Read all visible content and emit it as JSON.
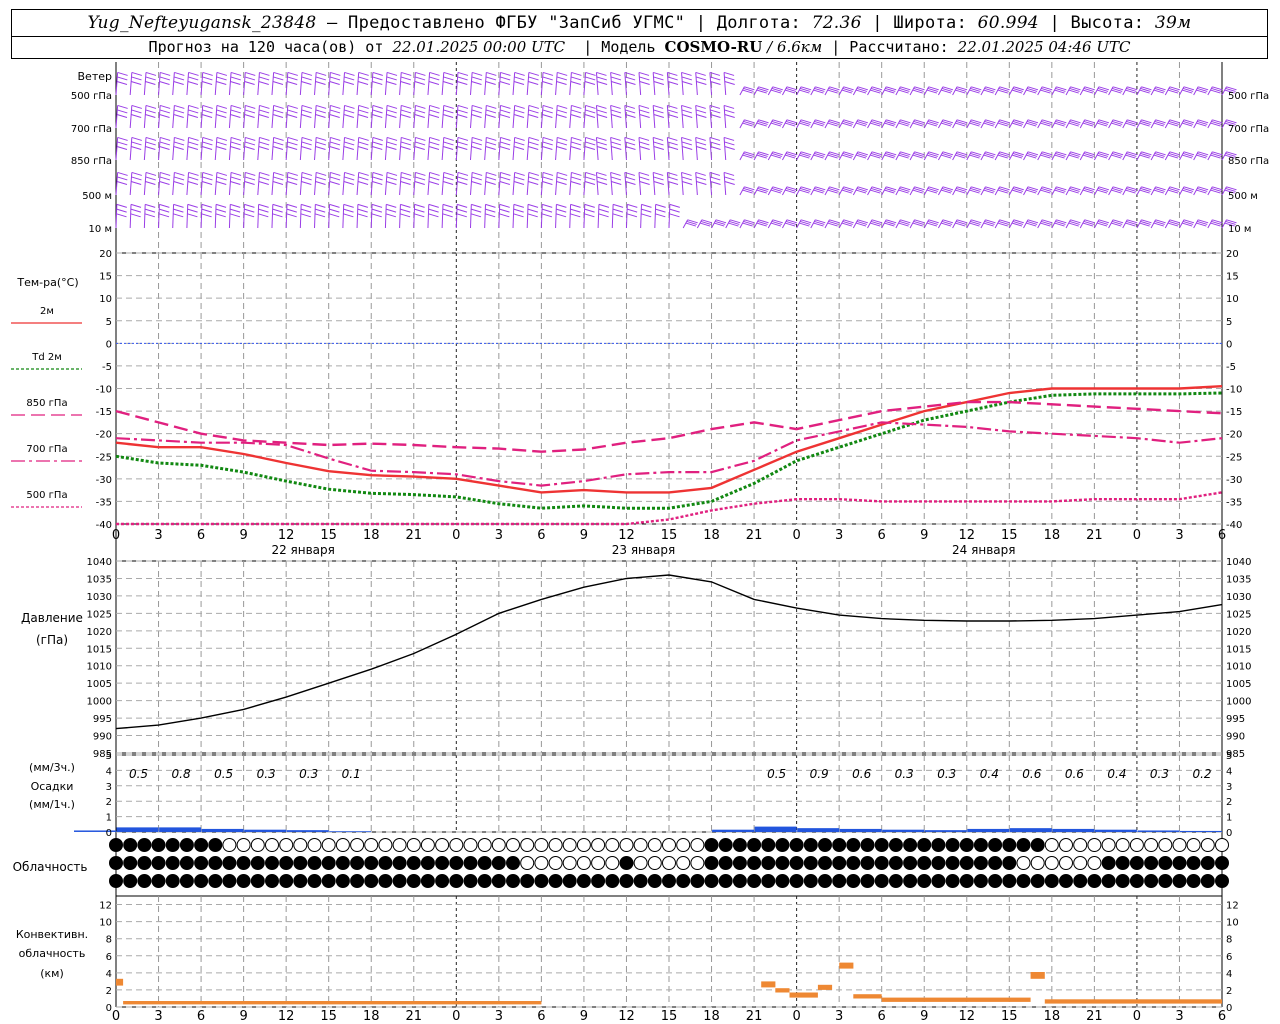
{
  "header": {
    "station": "Yug_Nefteyugansk_23848",
    "provider": " – Предоставлено ФГБУ \"ЗапСиб УГМС\" | Долгота: ",
    "lon": "72.36",
    "lat_label": " | Широта: ",
    "lat": "60.994",
    "alt_label": " | Высота: ",
    "alt": "39м",
    "forecast_label": "Прогноз на 120 часа(ов) от ",
    "run_time": "22.01.2025 00:00 UTC",
    "model_label": "  | Модель ",
    "model": "COSMO-RU",
    "resolution": " / 6.6км",
    "calc_label": " | Рассчитано: ",
    "calc_time": "22.01.2025 04:46 UTC"
  },
  "colors": {
    "wind": "#9a3de6",
    "t2m": "#ee3333",
    "td2m": "#118811",
    "t850": "#e0207f",
    "t700": "#e0207f",
    "t500": "#e0207f",
    "zero_line": "#3355ee",
    "pressure": "#000000",
    "precip": "#2255dd",
    "conv": "#ee8833"
  },
  "chart_data": [
    {
      "type": "wind_barbs",
      "label": "Ветер",
      "levels": [
        "500 гПа",
        "700 гПа",
        "850 гПа",
        "500 м",
        "10  м"
      ]
    },
    {
      "type": "line",
      "ylabel": "Тем-ра(°C)",
      "ylim": [
        -40,
        20
      ],
      "yticks": [
        20,
        15,
        10,
        5,
        0,
        -5,
        -10,
        -15,
        -20,
        -25,
        -30,
        -35,
        -40
      ],
      "x_hours": [
        0,
        3,
        6,
        9,
        12,
        15,
        18,
        21,
        24,
        27,
        30,
        33,
        36,
        39,
        42,
        45,
        48,
        51,
        54,
        57,
        60,
        63,
        66,
        69,
        72,
        75,
        78
      ],
      "x_tick_labels": [
        "0",
        "3",
        "6",
        "9",
        "12",
        "15",
        "18",
        "21",
        "0",
        "3",
        "6",
        "9",
        "12",
        "15",
        "18",
        "21",
        "0",
        "3",
        "6",
        "9",
        "12",
        "15",
        "18",
        "21",
        "0",
        "3",
        "6"
      ],
      "day_labels": [
        "22 января",
        "23 января",
        "24 января"
      ],
      "series": [
        {
          "name": "2м",
          "key": "t2m",
          "values": [
            -22,
            -23,
            -23,
            -24.5,
            -26.5,
            -28.3,
            -29.2,
            -29.5,
            -30,
            -31.5,
            -33,
            -32.5,
            -33,
            -33,
            -32,
            -28,
            -24,
            -21,
            -18,
            -15,
            -13,
            -11,
            -10,
            -10,
            -10,
            -10,
            -9.5
          ]
        },
        {
          "name": "Td  2м",
          "key": "td2m",
          "values": [
            -25,
            -26.5,
            -27,
            -28.5,
            -30.5,
            -32.3,
            -33.2,
            -33.5,
            -34,
            -35.5,
            -36.5,
            -36,
            -36.5,
            -36.5,
            -35,
            -31,
            -26,
            -23,
            -20,
            -17,
            -15,
            -13,
            -11.5,
            -11.2,
            -11.2,
            -11.2,
            -11
          ]
        },
        {
          "name": "850 гПа",
          "key": "t850",
          "values": [
            -15,
            -17.5,
            -20,
            -21.5,
            -22,
            -22.5,
            -22.2,
            -22.5,
            -23,
            -23.3,
            -24,
            -23.5,
            -22,
            -21,
            -19,
            -17.5,
            -19,
            -17,
            -15,
            -14,
            -13,
            -13,
            -13.5,
            -14,
            -14.5,
            -15,
            -15.5
          ]
        },
        {
          "name": "700 гПа",
          "key": "t700",
          "values": [
            -21,
            -21.5,
            -22,
            -22,
            -22.5,
            -25.5,
            -28.2,
            -28.5,
            -29,
            -30.5,
            -31.5,
            -30.5,
            -29,
            -28.5,
            -28.5,
            -26,
            -21.5,
            -19.5,
            -17.5,
            -18,
            -18.5,
            -19.5,
            -20,
            -20.5,
            -21,
            -22,
            -21
          ]
        },
        {
          "name": "500 гПа",
          "key": "t500",
          "values": [
            -40,
            -42,
            -43,
            -44,
            -44,
            -44,
            -43.5,
            -43.5,
            -44,
            -44,
            -44,
            -43,
            -41,
            -39,
            -37,
            -35.5,
            -34.5,
            -34.5,
            -35,
            -35,
            -35,
            -35,
            -35,
            -34.5,
            -34.5,
            -34.5,
            -33
          ]
        }
      ]
    },
    {
      "type": "line",
      "ylabel": "Давление",
      "yunit": "(гПа)",
      "ylim": [
        985,
        1040
      ],
      "yticks": [
        1040,
        1035,
        1030,
        1025,
        1020,
        1015,
        1010,
        1005,
        1000,
        995,
        990,
        985
      ],
      "x_hours": [
        0,
        3,
        6,
        9,
        12,
        15,
        18,
        21,
        24,
        27,
        30,
        33,
        36,
        39,
        42,
        45,
        48,
        51,
        54,
        57,
        60,
        63,
        66,
        69,
        72,
        75,
        78
      ],
      "series": [
        {
          "name": "Давление",
          "values": [
            992,
            993,
            995,
            997.5,
            1001,
            1005,
            1009,
            1013.5,
            1019,
            1025,
            1029,
            1032.5,
            1035,
            1036,
            1034,
            1029,
            1026.5,
            1024.5,
            1023.5,
            1023,
            1022.8,
            1022.8,
            1023,
            1023.5,
            1024.5,
            1025.5,
            1027.5
          ]
        }
      ]
    },
    {
      "type": "bar",
      "ylabel_top": "(мм/3ч.)",
      "ylabel_mid": "Осадки",
      "ylabel_bot": "(мм/1ч.)",
      "ylim": [
        0,
        5
      ],
      "yticks": [
        5,
        4,
        3,
        2,
        1,
        0
      ],
      "x_hours": [
        0,
        3,
        6,
        9,
        12,
        15,
        18,
        21,
        24,
        27,
        30,
        33,
        36,
        39,
        42,
        45,
        48,
        51,
        54,
        57,
        60,
        63,
        66,
        69,
        72,
        75,
        78
      ],
      "totals_3h": [
        "",
        "0.5",
        "0.8",
        "0.5",
        "0.3",
        "0.3",
        "0.1",
        "",
        "",
        "",
        "",
        "",
        "",
        "",
        "",
        "",
        "0.5",
        "0.9",
        "0.6",
        "0.3",
        "0.3",
        "0.4",
        "0.6",
        "0.6",
        "0.4",
        "0.3",
        "0.2"
      ],
      "hourly_mm": [
        0.1,
        0.3,
        0.3,
        0.2,
        0.15,
        0.12,
        0.05,
        0,
        0,
        0,
        0,
        0,
        0,
        0,
        0,
        0.15,
        0.35,
        0.25,
        0.2,
        0.15,
        0.12,
        0.2,
        0.25,
        0.2,
        0.15,
        0.1,
        0.07
      ]
    },
    {
      "type": "cloud_symbols",
      "label": "Облачность",
      "rows": 3,
      "columns": 79
    },
    {
      "type": "bar",
      "ylabel": "Конвективн.",
      "ylabel2": "облачность",
      "yunit": "(км)",
      "ylim": [
        0,
        13
      ],
      "yticks": [
        12,
        10,
        8,
        6,
        4,
        2,
        0
      ],
      "segments_km": [
        [
          0,
          0.5,
          2.5,
          3.3
        ],
        [
          0.5,
          30,
          0.3,
          0.7
        ],
        [
          30,
          48,
          0,
          0
        ],
        [
          45.5,
          46.5,
          2.3,
          3.0
        ],
        [
          46.5,
          47.5,
          1.7,
          2.2
        ],
        [
          47.5,
          49.5,
          1.1,
          1.7
        ],
        [
          49.5,
          50.5,
          2.0,
          2.6
        ],
        [
          51,
          52,
          4.5,
          5.2
        ],
        [
          52,
          54,
          1.0,
          1.5
        ],
        [
          54,
          64.5,
          0.6,
          1.1
        ],
        [
          64.5,
          65.5,
          3.3,
          4.1
        ],
        [
          65.5,
          78,
          0.4,
          0.9
        ]
      ]
    }
  ]
}
